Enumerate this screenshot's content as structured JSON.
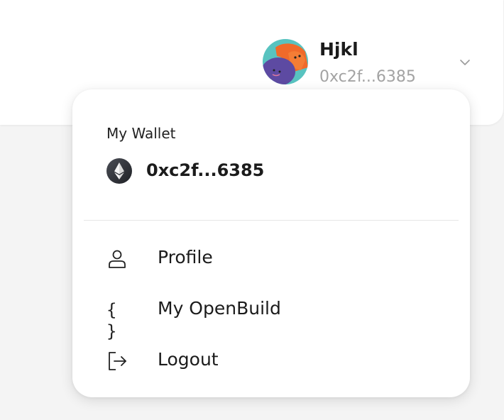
{
  "header": {
    "user": {
      "name": "Hjkl",
      "address": "0xc2f...6385",
      "avatar_icon": "user-avatar-illustration",
      "chevron_icon": "chevron-down-icon"
    }
  },
  "dropdown": {
    "wallet": {
      "label": "My Wallet",
      "address": "0xc2f...6385",
      "network_icon": "ethereum-icon"
    },
    "menu": [
      {
        "label": "Profile",
        "icon": "user-icon"
      },
      {
        "label": "My OpenBuild",
        "icon": "code-braces-icon",
        "glyph": "{ }"
      },
      {
        "label": "Logout",
        "icon": "logout-icon"
      }
    ]
  },
  "colors": {
    "background": "#f4f4f4",
    "card": "#ffffff",
    "text_primary": "#1b1b1b",
    "text_muted": "#a3a3a3",
    "divider": "#e6e6e6"
  }
}
